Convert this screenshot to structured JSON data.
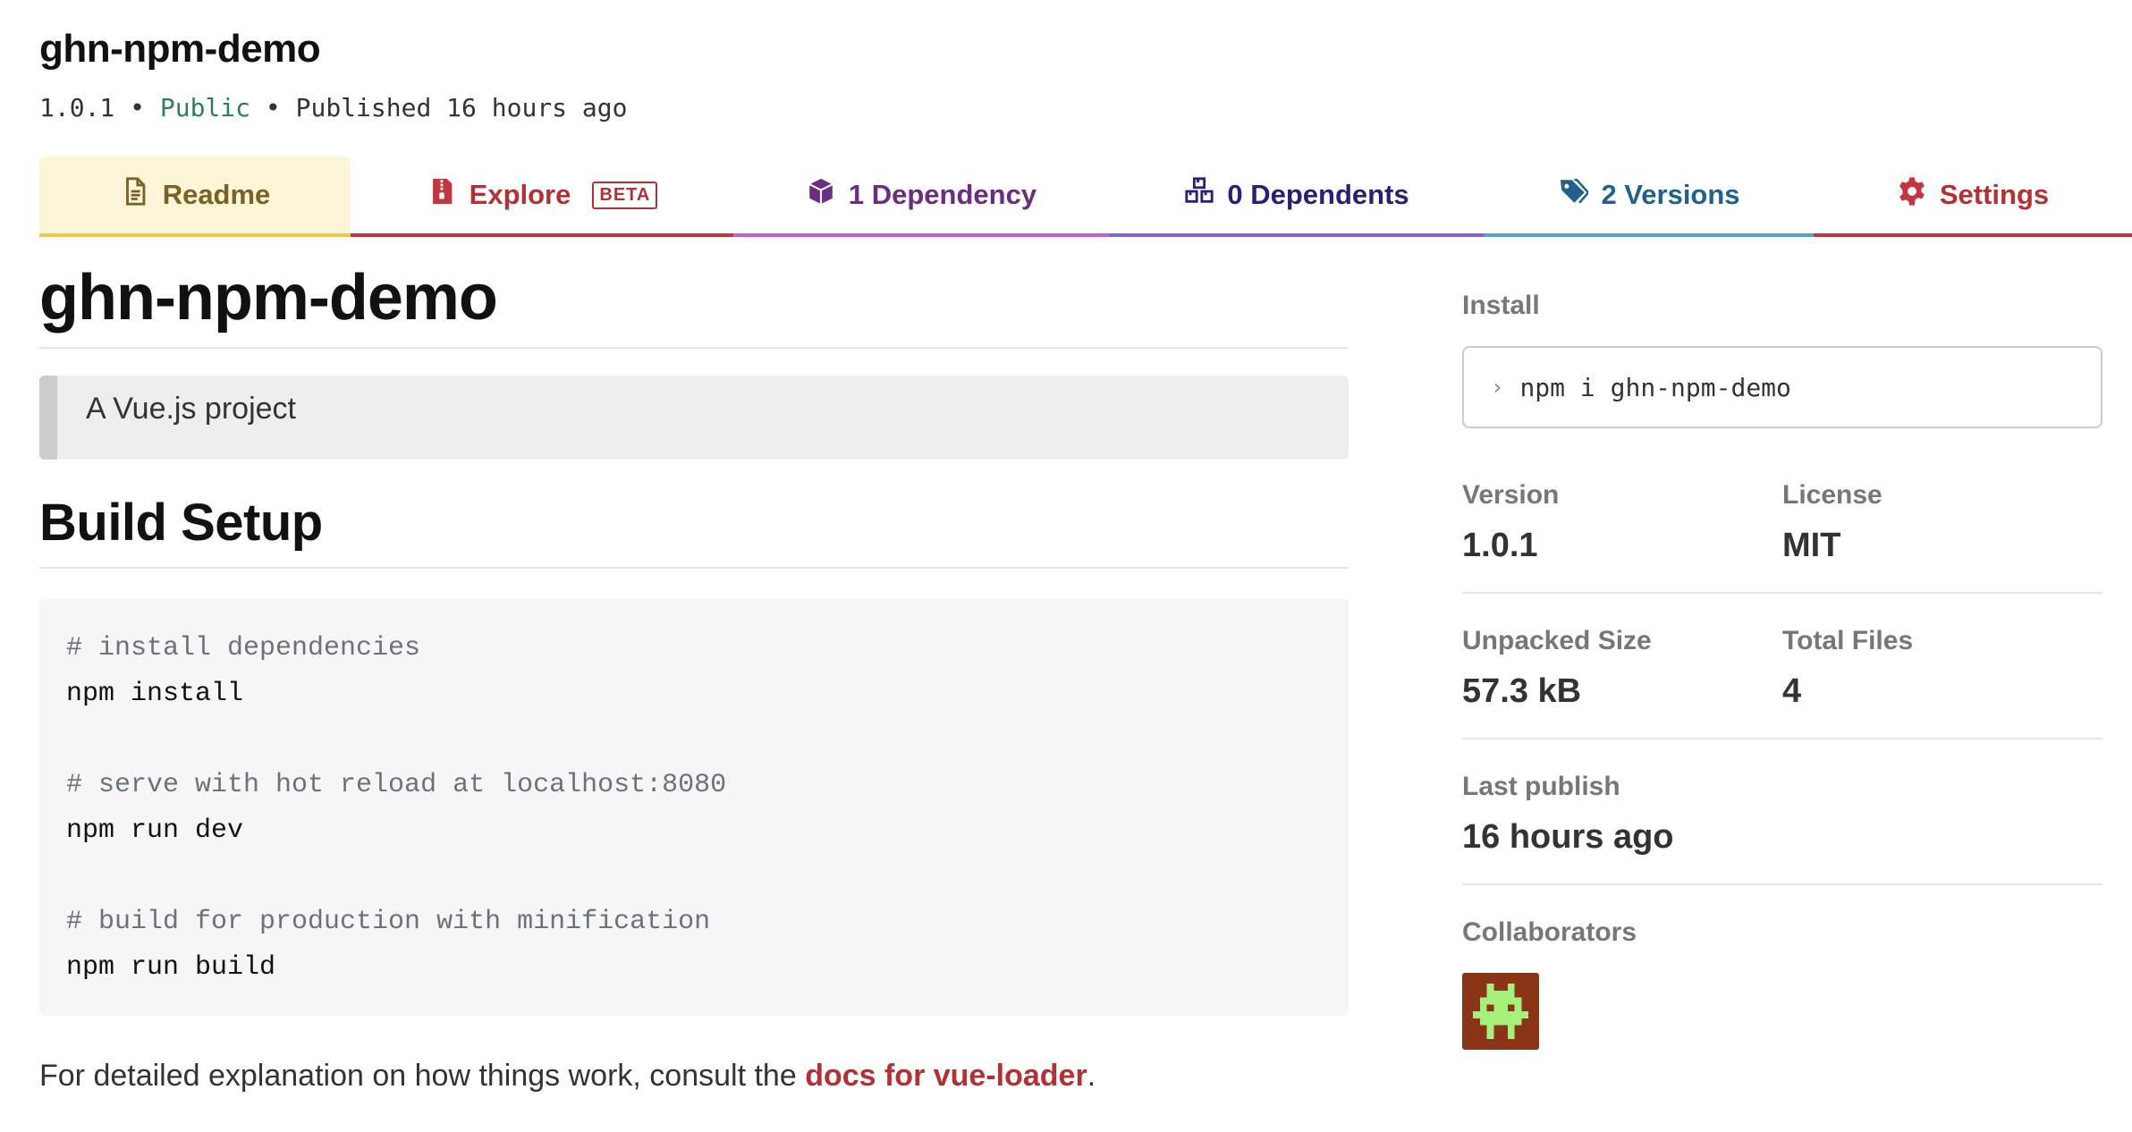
{
  "header": {
    "package_name": "ghn-npm-demo",
    "version": "1.0.1",
    "separator": " • ",
    "visibility": "Public",
    "published": "Published 16 hours ago"
  },
  "tabs": [
    {
      "label": "Readme",
      "icon": "file-icon",
      "color": "#7a6124"
    },
    {
      "label": "Explore",
      "icon": "archive-icon",
      "badge": "BETA",
      "color": "#b33035"
    },
    {
      "label": "1 Dependency",
      "icon": "box-icon",
      "color": "#6a2d82"
    },
    {
      "label": "0 Dependents",
      "icon": "boxes-icon",
      "color": "#2c1d79"
    },
    {
      "label": "2 Versions",
      "icon": "tags-icon",
      "color": "#20628d"
    },
    {
      "label": "Settings",
      "icon": "gear-icon",
      "color": "#b33035"
    }
  ],
  "readme": {
    "title": "ghn-npm-demo",
    "description": "A Vue.js project",
    "section_title": "Build Setup",
    "code": {
      "comment1": "# install dependencies",
      "cmd1": "npm install",
      "comment2": "# serve with hot reload at localhost:8080",
      "cmd2": "npm run dev",
      "comment3": "# build for production with minification",
      "cmd3": "npm run build"
    },
    "note_prefix": "For detailed explanation on how things work, consult the ",
    "note_link": "docs for vue-loader",
    "note_suffix": "."
  },
  "sidebar": {
    "install_label": "Install",
    "install_command": "npm i ghn-npm-demo",
    "install_prompt_icon": "chevron-right-icon",
    "version_label": "Version",
    "version_value": "1.0.1",
    "license_label": "License",
    "license_value": "MIT",
    "unpacked_label": "Unpacked Size",
    "unpacked_value": "57.3 kB",
    "files_label": "Total Files",
    "files_value": "4",
    "last_publish_label": "Last publish",
    "last_publish_value": "16 hours ago",
    "collaborators_label": "Collaborators",
    "avatar_colors": {
      "background": "#8a3418",
      "foreground": "#a6f07c"
    }
  }
}
